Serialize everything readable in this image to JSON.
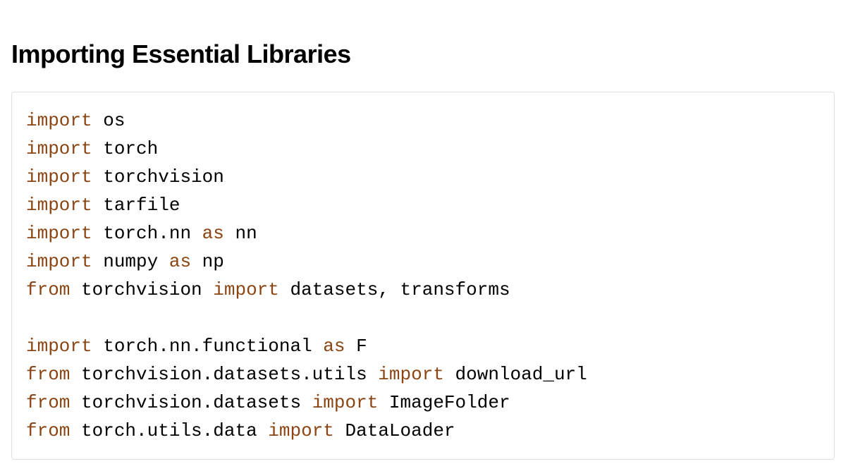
{
  "heading": "Importing Essential Libraries",
  "code": {
    "lines": [
      {
        "tokens": [
          {
            "t": "import",
            "c": "k"
          },
          {
            "t": " os",
            "c": ""
          }
        ]
      },
      {
        "tokens": [
          {
            "t": "import",
            "c": "k"
          },
          {
            "t": " torch",
            "c": ""
          }
        ]
      },
      {
        "tokens": [
          {
            "t": "import",
            "c": "k"
          },
          {
            "t": " torchvision",
            "c": ""
          }
        ]
      },
      {
        "tokens": [
          {
            "t": "import",
            "c": "k"
          },
          {
            "t": " tarfile",
            "c": ""
          }
        ]
      },
      {
        "tokens": [
          {
            "t": "import",
            "c": "k"
          },
          {
            "t": " torch.nn ",
            "c": ""
          },
          {
            "t": "as",
            "c": "k"
          },
          {
            "t": " nn",
            "c": ""
          }
        ]
      },
      {
        "tokens": [
          {
            "t": "import",
            "c": "k"
          },
          {
            "t": " numpy ",
            "c": ""
          },
          {
            "t": "as",
            "c": "k"
          },
          {
            "t": " np",
            "c": ""
          }
        ]
      },
      {
        "tokens": [
          {
            "t": "from",
            "c": "k"
          },
          {
            "t": " torchvision ",
            "c": ""
          },
          {
            "t": "import",
            "c": "k"
          },
          {
            "t": " datasets, transforms",
            "c": ""
          }
        ]
      },
      {
        "tokens": [
          {
            "t": "",
            "c": ""
          }
        ]
      },
      {
        "tokens": [
          {
            "t": "import",
            "c": "k"
          },
          {
            "t": " torch.nn.functional ",
            "c": ""
          },
          {
            "t": "as",
            "c": "k"
          },
          {
            "t": " F",
            "c": ""
          }
        ]
      },
      {
        "tokens": [
          {
            "t": "from",
            "c": "k"
          },
          {
            "t": " torchvision.datasets.utils ",
            "c": ""
          },
          {
            "t": "import",
            "c": "k"
          },
          {
            "t": " download_url",
            "c": ""
          }
        ]
      },
      {
        "tokens": [
          {
            "t": "from",
            "c": "k"
          },
          {
            "t": " torchvision.datasets ",
            "c": ""
          },
          {
            "t": "import",
            "c": "k"
          },
          {
            "t": " ImageFolder",
            "c": ""
          }
        ]
      },
      {
        "tokens": [
          {
            "t": "from",
            "c": "k"
          },
          {
            "t": " torch.utils.data ",
            "c": ""
          },
          {
            "t": "import",
            "c": "k"
          },
          {
            "t": " DataLoader",
            "c": ""
          }
        ]
      }
    ]
  }
}
